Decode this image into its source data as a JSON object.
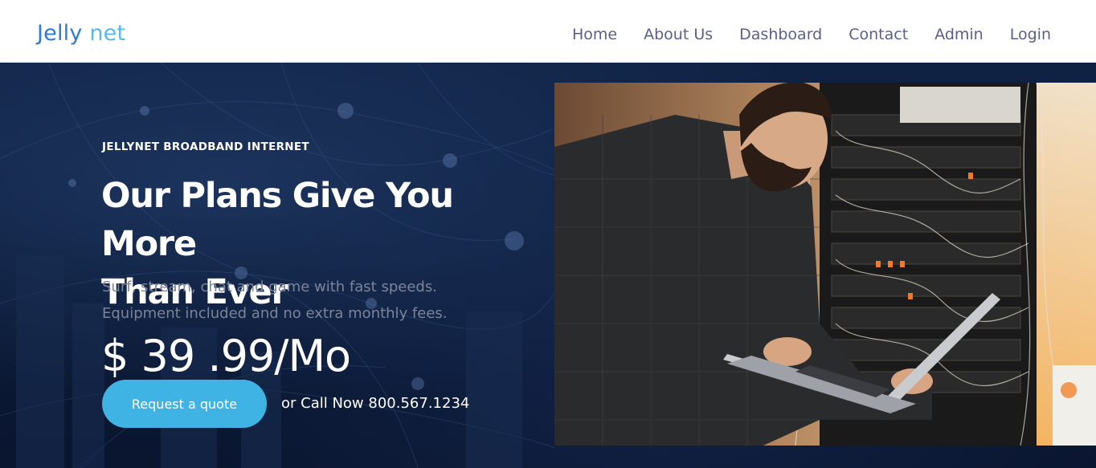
{
  "brand": {
    "part1": "Jelly",
    "part2": "net"
  },
  "nav": {
    "items": [
      "Home",
      "About Us",
      "Dashboard",
      "Contact",
      "Admin",
      "Login"
    ]
  },
  "hero": {
    "eyebrow": "JELLYNET BROADBAND INTERNET",
    "headline_line1": "Our Plans Give You More",
    "headline_line2": "Than Ever",
    "subtext_line1": "Surf, stream, chat and game with fast speeds.",
    "subtext_line2": "Equipment included and no extra monthly fees.",
    "price": "$ 39 .99/Mo",
    "cta_label": "Request a quote",
    "call_text": "or Call Now 800.567.1234"
  },
  "colors": {
    "brand_primary": "#2e7bd6",
    "brand_secondary": "#5bb8e8",
    "nav_text": "#5a5f8a",
    "hero_bg": "#0c1a33",
    "cta_bg": "#3fb3e3"
  },
  "icons": [
    "network-background-image",
    "technician-server-rack-photo"
  ]
}
